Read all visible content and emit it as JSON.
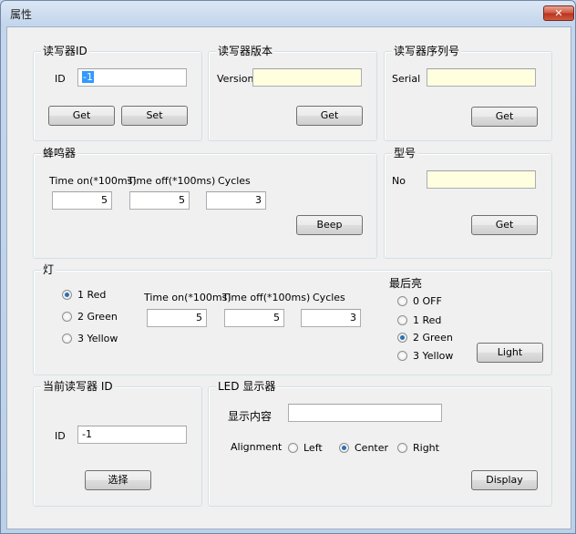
{
  "window": {
    "title": "属性",
    "close": "✕"
  },
  "reader_id": {
    "group": "读写器ID",
    "label": "ID",
    "value": "-1",
    "get": "Get",
    "set": "Set"
  },
  "reader_version": {
    "group": "读写器版本",
    "label": "Version",
    "value": "",
    "get": "Get"
  },
  "reader_serial": {
    "group": "读写器序列号",
    "label": "Serial",
    "value": "",
    "get": "Get"
  },
  "buzzer": {
    "group": "蜂鸣器",
    "time_on_label": "Time on(*100ms)",
    "time_on": "5",
    "time_off_label": "Time off(*100ms)",
    "time_off": "5",
    "cycles_label": "Cycles",
    "cycles": "3",
    "beep": "Beep"
  },
  "model": {
    "group": "型号",
    "label": "No",
    "value": "",
    "get": "Get"
  },
  "light": {
    "group": "灯",
    "colors": [
      "1 Red",
      "2 Green",
      "3 Yellow"
    ],
    "selected_color": "1 Red",
    "time_on_label": "Time on(*100ms)",
    "time_on": "5",
    "time_off_label": "Time off(*100ms)",
    "time_off": "5",
    "cycles_label": "Cycles",
    "cycles": "3",
    "last_label": "最后亮",
    "last_options": [
      "0 OFF",
      "1 Red",
      "2 Green",
      "3 Yellow"
    ],
    "last_selected": "2 Green",
    "button": "Light"
  },
  "current_reader": {
    "group": "当前读写器 ID",
    "label": "ID",
    "value": "-1",
    "select": "选择"
  },
  "led": {
    "group": "LED 显示器",
    "content_label": "显示内容",
    "content": "",
    "alignment_label": "Alignment",
    "alignments": [
      "Left",
      "Center",
      "Right"
    ],
    "selected_alignment": "Center",
    "display": "Display"
  }
}
